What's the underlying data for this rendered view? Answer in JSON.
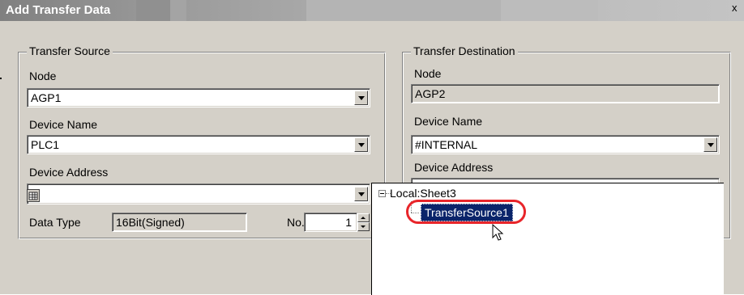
{
  "window": {
    "title": "Add Transfer Data",
    "close_glyph": "x"
  },
  "source": {
    "legend": "Transfer Source",
    "node_label": "Node",
    "node_value": "AGP1",
    "device_name_label": "Device Name",
    "device_name_value": "PLC1",
    "device_address_label": "Device Address",
    "device_address_value": "",
    "data_type_label": "Data Type",
    "data_type_value": "16Bit(Signed)",
    "no_label": "No.",
    "no_value": "1"
  },
  "destination": {
    "legend": "Transfer Destination",
    "node_label": "Node",
    "node_value": "AGP2",
    "device_name_label": "Device Name",
    "device_name_value": "#INTERNAL",
    "device_address_label": "Device Address"
  },
  "tree": {
    "root_label": "Local:Sheet3",
    "selected_item": "TransferSource1"
  },
  "icons": {
    "address_icon": "address-input-icon",
    "dropdown": "chevron-down-icon",
    "collapse": "tree-collapse-icon",
    "cursor": "mouse-pointer-icon"
  },
  "colors": {
    "highlight": "#0a246a",
    "annotation_ring": "#e8252a",
    "dialog_face": "#d4d0c8"
  }
}
